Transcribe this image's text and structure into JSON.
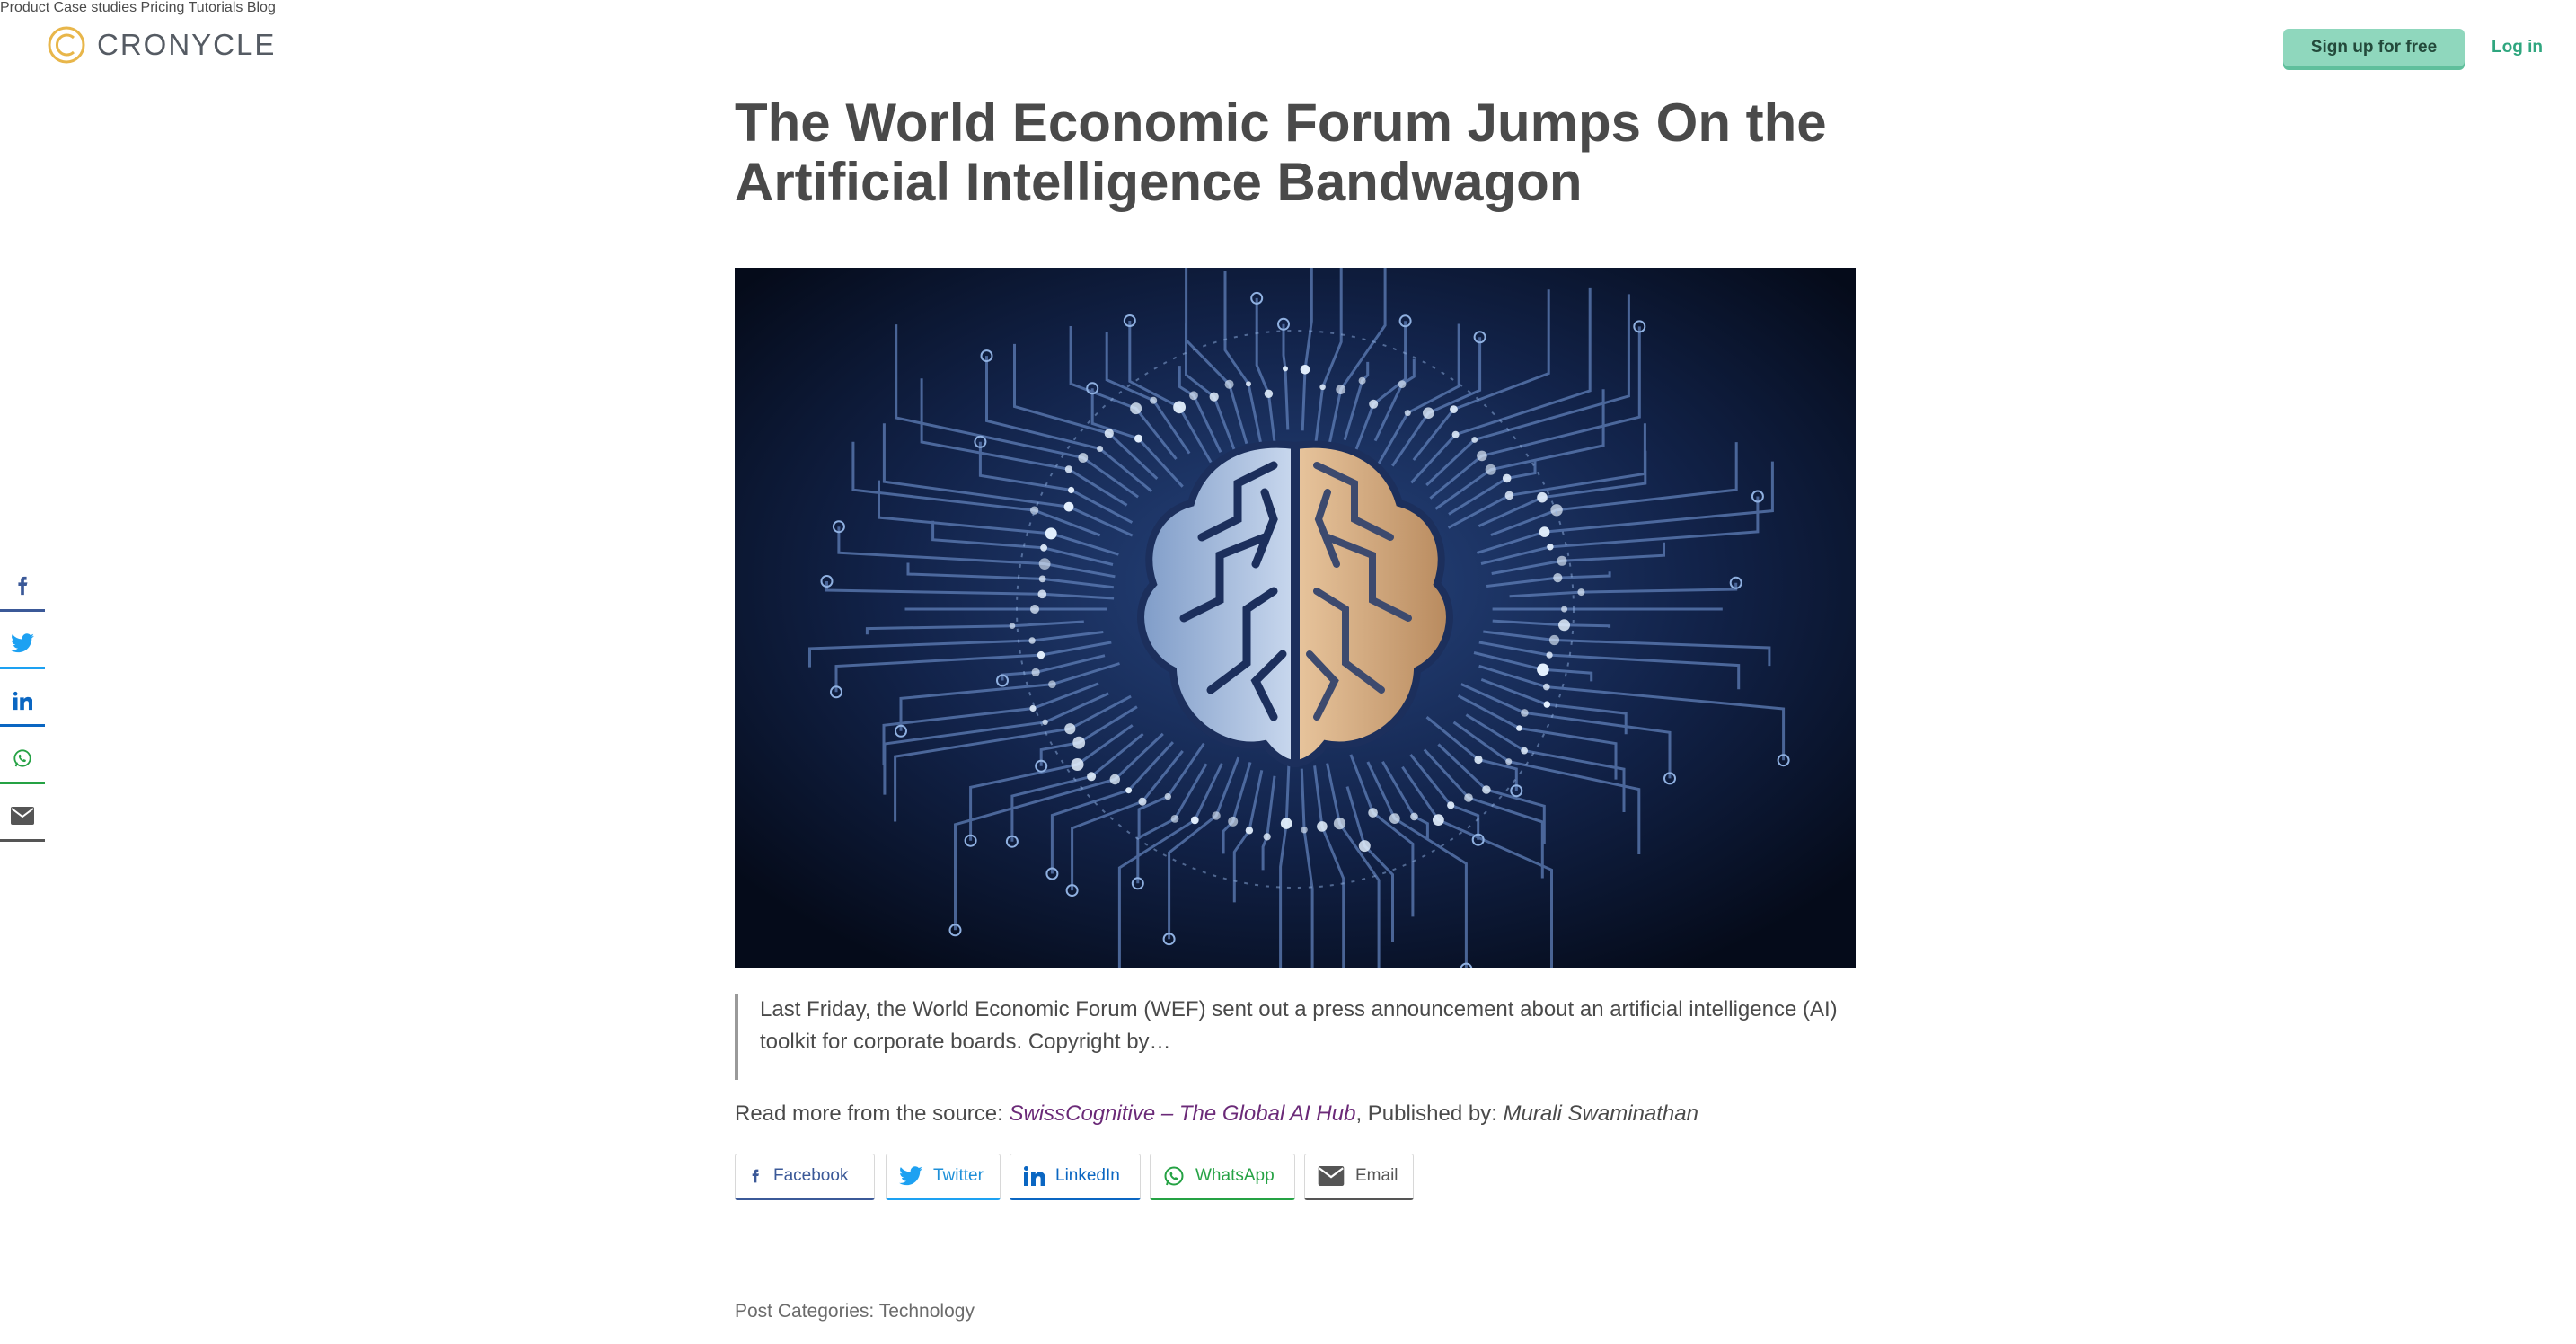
{
  "brand": {
    "name": "CRONYCLE",
    "color": "#e8b64a"
  },
  "nav": {
    "items": [
      "Product",
      "Case studies",
      "Pricing",
      "Tutorials",
      "Blog"
    ],
    "signup_label": "Sign up for free",
    "login_label": "Log in",
    "accent": "#8fd7bd"
  },
  "floating_share": {
    "icons": [
      "facebook-icon",
      "twitter-icon",
      "linkedin-icon",
      "whatsapp-icon",
      "email-icon"
    ]
  },
  "article": {
    "title": "The World Economic Forum Jumps On the Artificial Intelligence Bandwagon",
    "excerpt": "Last Friday, the World Economic Forum (WEF) sent out a press announcement about an artificial intelligence (AI) toolkit for corporate boards. Copyright by…",
    "read_more_prefix": "Read more from the source: ",
    "source_name": "SwissCognitive – The Global AI Hub",
    "published_by_prefix": ", Published by: ",
    "author": "Murali Swaminathan"
  },
  "share_buttons": {
    "facebook": "Facebook",
    "twitter": "Twitter",
    "linkedin": "LinkedIn",
    "whatsapp": "WhatsApp",
    "email": "Email"
  },
  "colors": {
    "facebook": "#3b5998",
    "twitter": "#1da1f2",
    "linkedin": "#0a66c2",
    "whatsapp": "#25a244",
    "email": "#555555",
    "source_link": "#6b2a78"
  },
  "footer": {
    "categories_label": "Post Categories: ",
    "category": "Technology"
  }
}
